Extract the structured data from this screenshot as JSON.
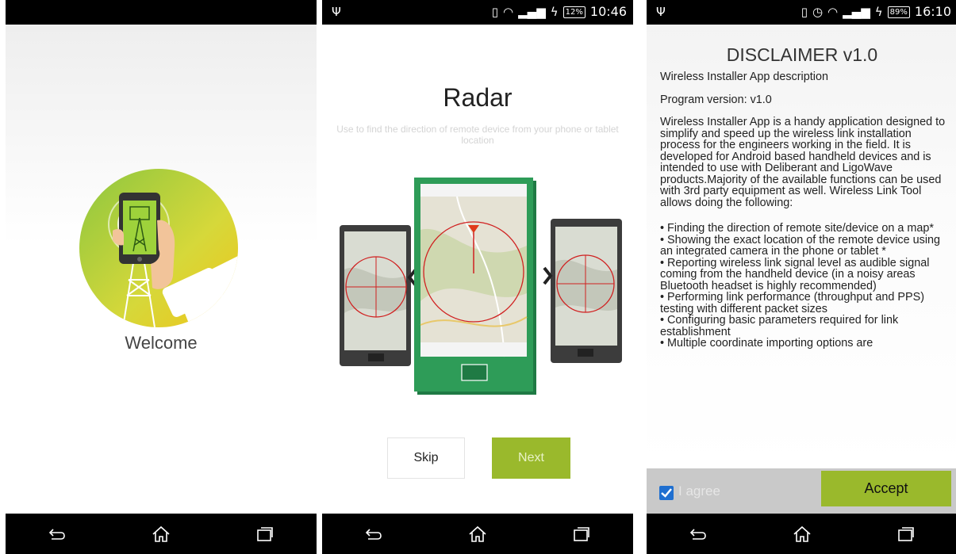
{
  "screens": {
    "welcome": {
      "label": "Welcome"
    },
    "radar": {
      "status_time": "10:46",
      "battery": "12%",
      "title": "Radar",
      "description": "Use to find the direction of remote device from your phone or tablet location",
      "skip_label": "Skip",
      "next_label": "Next"
    },
    "disclaimer": {
      "status_time": "16:10",
      "battery": "89%",
      "title": "DISCLAIMER v1.0",
      "lines": [
        "Wireless Installer App description",
        "Program version: v1.0"
      ],
      "paragraph": "Wireless Installer App is a handy application designed to simplify and speed up the wireless link installation process for the engineers working in the field. It is developed for Android based handheld devices and is intended to use with Deliberant and LigoWave products.Majority of the available functions can be used with 3rd party equipment as well. Wireless Link Tool allows doing the following:",
      "bullets": [
        "• Finding the direction of remote site/device on a map*",
        "• Showing the exact location of the remote device using an integrated camera in the phone or tablet *",
        "• Reporting wireless link signal level as audible signal coming from the handheld device (in a noisy areas Bluetooth headset is highly recommended)",
        "• Performing link performance (throughput and PPS) testing with different packet sizes",
        "• Configuring basic parameters required for link establishment",
        "• Multiple coordinate importing options are"
      ],
      "agree_label": "I agree",
      "agree_checked": true,
      "accept_label": "Accept"
    }
  },
  "colors": {
    "accent_green": "#9ab92c",
    "device_green": "#2e9c58",
    "checkbox_blue": "#1f6fd0"
  }
}
